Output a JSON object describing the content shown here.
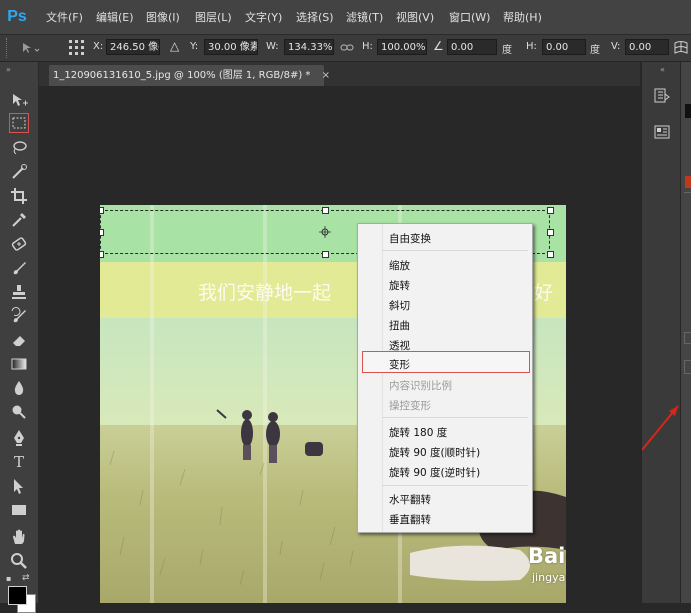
{
  "app": {
    "logo": "Ps"
  },
  "menu": [
    "文件(F)",
    "编辑(E)",
    "图像(I)",
    "图层(L)",
    "文字(Y)",
    "选择(S)",
    "滤镜(T)",
    "视图(V)",
    "窗口(W)",
    "帮助(H)"
  ],
  "options": {
    "x_label": "X:",
    "x_value": "246.50 像§",
    "y_label": "Y:",
    "y_value": "30.00 像素",
    "w_label": "W:",
    "w_value": "134.33%",
    "h_label": "H:",
    "h_value": "100.00%",
    "angle_value": "0.00",
    "angle_unit": "度",
    "hskew_label": "H:",
    "hskew_value": "0.00",
    "hskew_unit": "度",
    "vskew_label": "V:",
    "vskew_value": "0.00"
  },
  "document": {
    "tab_title": "1_120906131610_5.jpg @ 100% (图层 1, RGB/8#) *",
    "close_glyph": "×",
    "banner_text_left": "我们安静地一起",
    "banner_text_right": "好"
  },
  "context_menu": {
    "items": [
      {
        "label": "自由变换",
        "enabled": true
      },
      {
        "label": "缩放",
        "enabled": true
      },
      {
        "label": "旋转",
        "enabled": true
      },
      {
        "label": "斜切",
        "enabled": true
      },
      {
        "label": "扭曲",
        "enabled": true
      },
      {
        "label": "透视",
        "enabled": true
      },
      {
        "label": "变形",
        "enabled": true,
        "highlighted": true
      },
      {
        "label": "内容识别比例",
        "enabled": false
      },
      {
        "label": "操控变形",
        "enabled": false
      },
      {
        "label": "旋转 180 度",
        "enabled": true
      },
      {
        "label": "旋转 90 度(顺时针)",
        "enabled": true
      },
      {
        "label": "旋转 90 度(逆时针)",
        "enabled": true
      },
      {
        "label": "水平翻转",
        "enabled": true
      },
      {
        "label": "垂直翻转",
        "enabled": true
      }
    ]
  },
  "watermark": {
    "brand": "Baidu经验",
    "url": "jingyan.baidu.com"
  },
  "colors": {
    "highlight_box": "#d9534f",
    "arrow": "#d6261c",
    "ps_blue": "#2fa8f0"
  }
}
